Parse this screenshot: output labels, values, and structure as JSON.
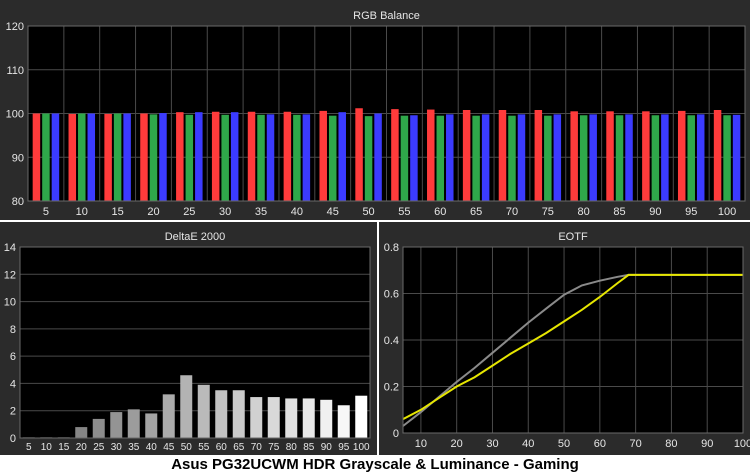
{
  "caption": "Asus PG32UCWM HDR Grayscale & Luminance - Gaming",
  "colors": {
    "panel_bg": "#2b2b2b",
    "plot_bg": "#000000",
    "grid": "#4a4a4a",
    "text": "#e6e6e6",
    "red": "#ff3b3b",
    "green": "#2fa84a",
    "blue": "#3b3bff",
    "eotf_target": "#8a8a8a",
    "eotf_measured": "#e6e600"
  },
  "chart_data": [
    {
      "type": "bar",
      "title": "RGB Balance",
      "categories": [
        "5",
        "10",
        "15",
        "20",
        "25",
        "30",
        "35",
        "40",
        "45",
        "50",
        "55",
        "60",
        "65",
        "70",
        "75",
        "80",
        "85",
        "90",
        "95",
        "100"
      ],
      "ylim": [
        80,
        120
      ],
      "yticks": [
        "80",
        "90",
        "100",
        "110",
        "120"
      ],
      "grid": true,
      "series": [
        {
          "key": "red",
          "values": [
            100.0,
            99.9,
            99.9,
            100.0,
            100.3,
            100.4,
            100.4,
            100.4,
            100.6,
            101.2,
            101.0,
            100.9,
            100.8,
            100.8,
            100.8,
            100.5,
            100.5,
            100.5,
            100.6,
            100.8
          ]
        },
        {
          "key": "green",
          "values": [
            100.0,
            100.0,
            100.0,
            99.8,
            99.7,
            99.7,
            99.7,
            99.7,
            99.5,
            99.4,
            99.5,
            99.5,
            99.5,
            99.5,
            99.5,
            99.6,
            99.6,
            99.6,
            99.6,
            99.6
          ]
        },
        {
          "key": "blue",
          "values": [
            100.0,
            100.0,
            100.0,
            100.1,
            100.3,
            100.3,
            99.8,
            99.8,
            100.3,
            100.0,
            99.6,
            99.8,
            99.8,
            99.8,
            99.8,
            99.8,
            99.8,
            99.8,
            99.8,
            99.7
          ]
        }
      ]
    },
    {
      "type": "bar",
      "title": "DeltaE 2000",
      "categories": [
        "5",
        "10",
        "15",
        "20",
        "25",
        "30",
        "35",
        "40",
        "45",
        "50",
        "55",
        "60",
        "65",
        "70",
        "75",
        "80",
        "85",
        "90",
        "95",
        "100"
      ],
      "values": [
        0.05,
        0.05,
        0.05,
        0.8,
        1.4,
        1.9,
        2.1,
        1.8,
        3.2,
        4.6,
        3.9,
        3.5,
        3.5,
        3.0,
        3.0,
        2.9,
        2.9,
        2.8,
        2.4,
        3.1
      ],
      "ylim": [
        0,
        14
      ],
      "yticks": [
        "0",
        "2",
        "4",
        "6",
        "8",
        "10",
        "12",
        "14"
      ],
      "grid": true
    },
    {
      "type": "line",
      "title": "EOTF",
      "xlim": [
        5,
        100
      ],
      "ylim": [
        0,
        0.8
      ],
      "xticks": [
        "10",
        "20",
        "30",
        "40",
        "50",
        "60",
        "70",
        "80",
        "90",
        "100"
      ],
      "yticks": [
        "0",
        "0.2",
        "0.4",
        "0.6",
        "0.8"
      ],
      "grid": true,
      "series": [
        {
          "key": "target",
          "x": [
            5,
            10,
            15,
            20,
            25,
            30,
            35,
            40,
            45,
            50,
            55,
            60,
            65,
            68,
            70,
            75,
            80,
            85,
            90,
            95,
            100
          ],
          "y": [
            0.03,
            0.09,
            0.155,
            0.22,
            0.28,
            0.345,
            0.41,
            0.475,
            0.535,
            0.595,
            0.635,
            0.655,
            0.672,
            0.68,
            0.68,
            0.68,
            0.68,
            0.68,
            0.68,
            0.68,
            0.68
          ]
        },
        {
          "key": "measured",
          "x": [
            5,
            10,
            15,
            20,
            25,
            30,
            35,
            40,
            45,
            50,
            55,
            60,
            65,
            68,
            70,
            75,
            80,
            85,
            90,
            95,
            100
          ],
          "y": [
            0.06,
            0.1,
            0.15,
            0.2,
            0.24,
            0.29,
            0.34,
            0.385,
            0.43,
            0.48,
            0.53,
            0.585,
            0.645,
            0.68,
            0.68,
            0.68,
            0.68,
            0.68,
            0.68,
            0.68,
            0.68
          ]
        }
      ]
    }
  ]
}
